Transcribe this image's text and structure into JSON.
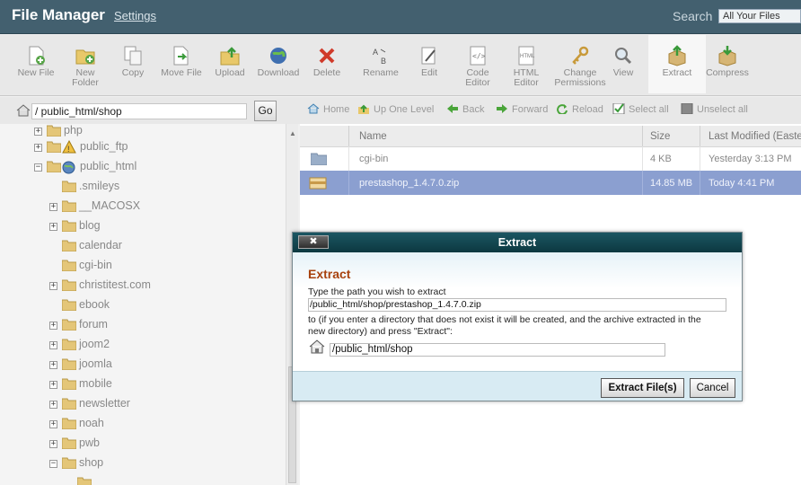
{
  "header": {
    "title": "File Manager",
    "settings_label": "Settings",
    "search_label": "Search",
    "search_scope": "All Your Files"
  },
  "toolbar": {
    "new_file": "New File",
    "new_folder_1": "New",
    "new_folder_2": "Folder",
    "copy": "Copy",
    "move_file": "Move File",
    "upload": "Upload",
    "download": "Download",
    "delete": "Delete",
    "rename": "Rename",
    "edit": "Edit",
    "code_editor_1": "Code",
    "code_editor_2": "Editor",
    "html_editor_1": "HTML",
    "html_editor_2": "Editor",
    "change_permissions_1": "Change",
    "change_permissions_2": "Permissions",
    "view": "View",
    "extract": "Extract",
    "compress": "Compress"
  },
  "pathbar": {
    "path": "/ public_html/shop",
    "go_label": "Go"
  },
  "navbar": {
    "home": "Home",
    "up_one_level": "Up One Level",
    "back": "Back",
    "forward": "Forward",
    "reload": "Reload",
    "select_all": "Select all",
    "unselect_all": "Unselect all"
  },
  "tree": {
    "items": [
      {
        "label": "php"
      },
      {
        "label": "public_ftp"
      },
      {
        "label": "public_html"
      },
      {
        "label": ".smileys"
      },
      {
        "label": "__MACOSX"
      },
      {
        "label": "blog"
      },
      {
        "label": "calendar"
      },
      {
        "label": "cgi-bin"
      },
      {
        "label": "christitest.com"
      },
      {
        "label": "ebook"
      },
      {
        "label": "forum"
      },
      {
        "label": "joom2"
      },
      {
        "label": "joomla"
      },
      {
        "label": "mobile"
      },
      {
        "label": "newsletter"
      },
      {
        "label": "noah"
      },
      {
        "label": "pwb"
      },
      {
        "label": "shop"
      }
    ]
  },
  "files": {
    "columns": {
      "name": "Name",
      "size": "Size",
      "modified": "Last Modified (Easter"
    },
    "rows": [
      {
        "name": "cgi-bin",
        "size": "4 KB",
        "modified": "Yesterday 3:13 PM"
      },
      {
        "name": "prestashop_1.4.7.0.zip",
        "size": "14.85 MB",
        "modified": "Today 4:41 PM"
      }
    ]
  },
  "modal": {
    "close_label": "✖",
    "title": "Extract",
    "heading": "Extract",
    "prompt": "Type the path you wish to extract",
    "source_path": "/public_html/shop/prestashop_1.4.7.0.zip",
    "info_line1": "to (if you enter a directory that does not exist it will be created, and the archive extracted in the",
    "info_line2": "new directory) and press \"Extract\":",
    "dest_path": "/public_html/shop",
    "extract_button": "Extract File(s)",
    "cancel_button": "Cancel"
  },
  "colors": {
    "header_bg": "#43606f",
    "selected_row": "#8b9fd0",
    "modal_title_bg": "#0c3840",
    "modal_heading": "#a8420d"
  }
}
